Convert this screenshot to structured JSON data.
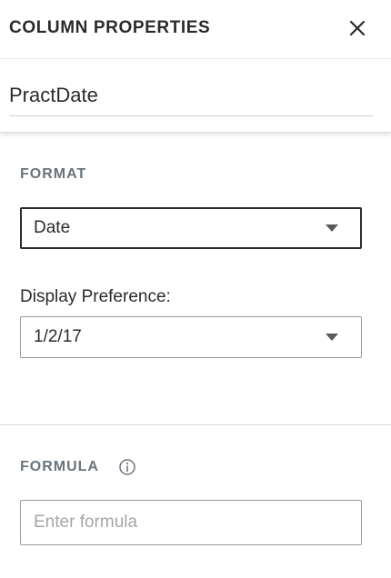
{
  "header": {
    "title": "COLUMN PROPERTIES",
    "close_icon": "close-icon"
  },
  "column": {
    "name": "PractDate"
  },
  "format_section": {
    "label": "FORMAT",
    "format_select": {
      "value": "Date"
    },
    "display_preference": {
      "label": "Display Preference:",
      "value": "1/2/17"
    }
  },
  "formula_section": {
    "label": "FORMULA",
    "info_icon": "info-icon",
    "input": {
      "value": "",
      "placeholder": "Enter formula"
    }
  },
  "colors": {
    "section_label": "#6a737c",
    "text": "#2b2b2b",
    "border": "#9a9a9a",
    "active_border": "#2c2c2c"
  }
}
